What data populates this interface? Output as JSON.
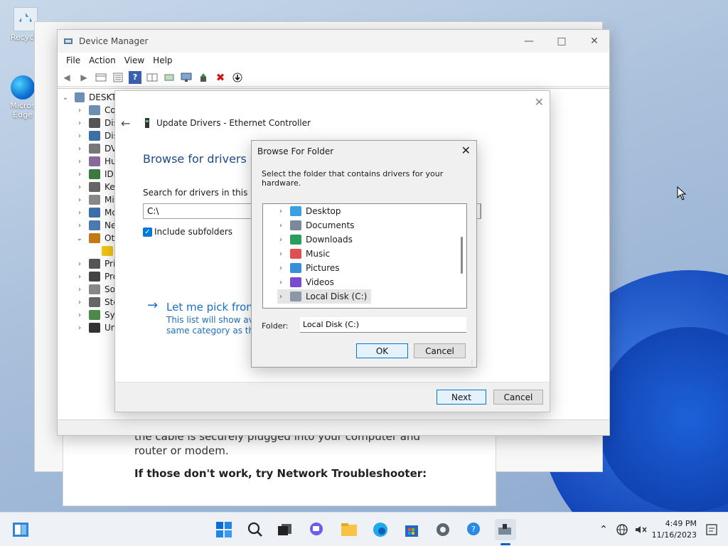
{
  "desktop": {
    "icons": [
      {
        "label": "Recycle"
      },
      {
        "label": "Micros\nEdge"
      }
    ]
  },
  "background": {
    "page_line1": "the cable is securely plugged into your computer and",
    "page_line2": "router or modem.",
    "page_line3": "If those don't work, try Network Troubleshooter:"
  },
  "device_manager": {
    "title": "Device Manager",
    "menu": [
      "File",
      "Action",
      "View",
      "Help"
    ],
    "tree_root": "DESKTO",
    "tree_items": [
      "Cor",
      "Disk",
      "Disp",
      "DVD",
      "Hun",
      "IDE",
      "Key",
      "Mic",
      "Mo",
      "Net",
      "Oth",
      "",
      "Prin",
      "Pro",
      "Soft",
      "Stor",
      "Syst",
      "Uni"
    ]
  },
  "update_drivers": {
    "title": "Update Drivers - Ethernet Controller",
    "heading": "Browse for drivers on",
    "search_label": "Search for drivers in this locat",
    "path_value": "C:\\",
    "include_subfolders": "Include subfolders",
    "pick_link": "Let me pick from",
    "pick_desc1": "This list will show avail",
    "pick_desc2": "same category as the d",
    "next": "Next",
    "cancel": "Cancel"
  },
  "browse_folder": {
    "title": "Browse For Folder",
    "instruction": "Select the folder that contains drivers for your hardware.",
    "items": [
      "Desktop",
      "Documents",
      "Downloads",
      "Music",
      "Pictures",
      "Videos",
      "Local Disk (C:)"
    ],
    "folder_label": "Folder:",
    "folder_value": "Local Disk (C:)",
    "ok": "OK",
    "cancel": "Cancel"
  },
  "taskbar": {
    "time": "4:49 PM",
    "date": "11/16/2023"
  },
  "colors": {
    "accent": "#0078d4",
    "link": "#1a6fc4"
  }
}
